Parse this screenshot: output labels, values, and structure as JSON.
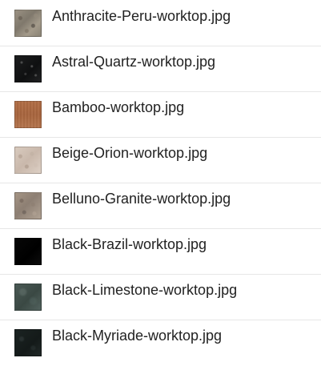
{
  "files": [
    {
      "name": "Anthracite-Peru-worktop.jpg",
      "texture": "anthracite-peru"
    },
    {
      "name": "Astral-Quartz-worktop.jpg",
      "texture": "astral-quartz"
    },
    {
      "name": "Bamboo-worktop.jpg",
      "texture": "bamboo"
    },
    {
      "name": "Beige-Orion-worktop.jpg",
      "texture": "beige-orion"
    },
    {
      "name": "Belluno-Granite-worktop.jpg",
      "texture": "belluno-granite"
    },
    {
      "name": "Black-Brazil-worktop.jpg",
      "texture": "black-brazil"
    },
    {
      "name": "Black-Limestone-worktop.jpg",
      "texture": "black-limestone"
    },
    {
      "name": "Black-Myriade-worktop.jpg",
      "texture": "black-myriade"
    }
  ]
}
